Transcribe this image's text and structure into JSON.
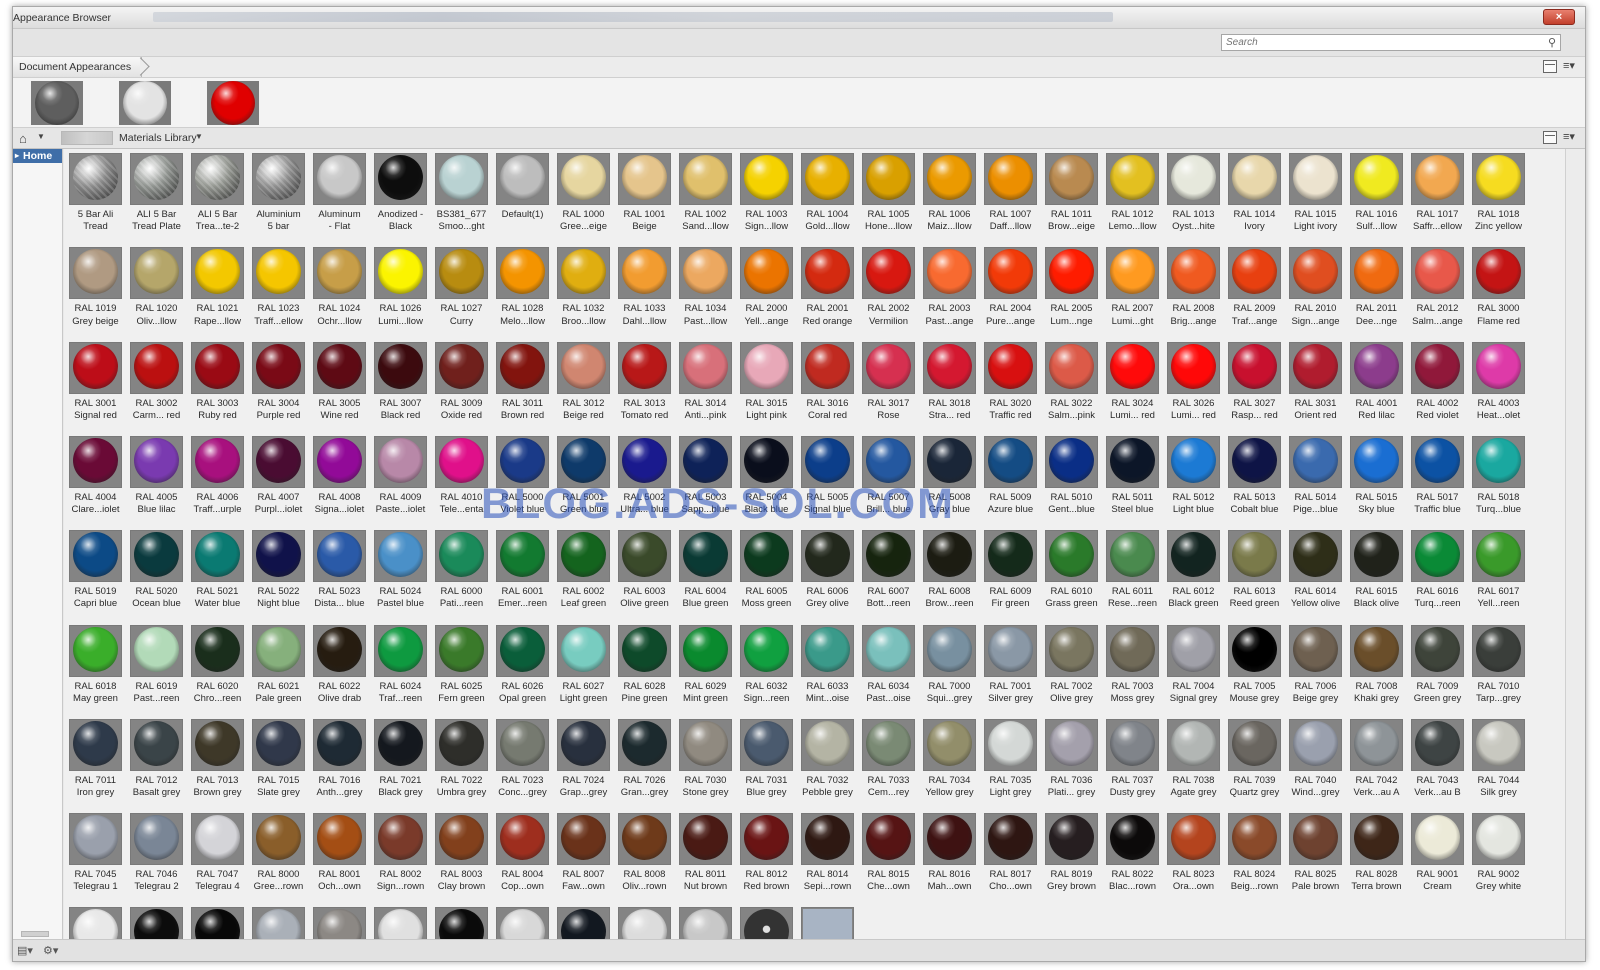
{
  "window": {
    "title": "Appearance Browser",
    "close_label": "×"
  },
  "search": {
    "placeholder": "Search",
    "icon": "search-icon"
  },
  "document": {
    "breadcrumb": "Document Appearances",
    "swatches": [
      {
        "name": "dark-chrome",
        "color": "#5e5e5e"
      },
      {
        "name": "white-matte",
        "color": "#e3e3e3"
      },
      {
        "name": "red-glossy",
        "color": "#e00000"
      }
    ]
  },
  "library": {
    "breadcrumb": "Materials Library",
    "home_icon": "home-icon"
  },
  "sidebar": {
    "items": [
      {
        "label": "Home"
      }
    ]
  },
  "watermark": "BLOG.ADS-SOL.COM",
  "materials": [
    {
      "label": "5 Bar Ali\nTread",
      "color": "#8a8a8a",
      "pattern": "tread"
    },
    {
      "label": "ALI 5 Bar\nTread Plate",
      "color": "#8f938f",
      "pattern": "tread"
    },
    {
      "label": "ALI 5 Bar\nTrea...te-2",
      "color": "#939690",
      "pattern": "tread"
    },
    {
      "label": "Aluminium\n5 bar",
      "color": "#8f8f8f",
      "pattern": "tread"
    },
    {
      "label": "Aluminum\n- Flat",
      "color": "#c8c8c8"
    },
    {
      "label": "Anodized -\nBlack",
      "color": "#0d0d0d"
    },
    {
      "label": "BS381_677\nSmoo...ght",
      "color": "#b9d2d2"
    },
    {
      "label": "Default(1)",
      "color": "#bdbdbd"
    },
    {
      "label": "RAL 1000\nGree...eige",
      "color": "#e6d6a0"
    },
    {
      "label": "RAL 1001\nBeige",
      "color": "#e5c58c"
    },
    {
      "label": "RAL 1002\nSand...llow",
      "color": "#e0c06c"
    },
    {
      "label": "RAL 1003\nSign...llow",
      "color": "#f5d200"
    },
    {
      "label": "RAL 1004\nGold...llow",
      "color": "#e8b000"
    },
    {
      "label": "RAL 1005\nHone...llow",
      "color": "#d9a000"
    },
    {
      "label": "RAL 1006\nMaiz...llow",
      "color": "#eb9a00"
    },
    {
      "label": "RAL 1007\nDaff...llow",
      "color": "#ec8f00"
    },
    {
      "label": "RAL 1011\nBrow...eige",
      "color": "#b98a50"
    },
    {
      "label": "RAL 1012\nLemo...llow",
      "color": "#e3c020"
    },
    {
      "label": "RAL 1013\nOyst...hite",
      "color": "#e6e8dc"
    },
    {
      "label": "RAL 1014\nIvory",
      "color": "#e8d7ab"
    },
    {
      "label": "RAL 1015\nLight ivory",
      "color": "#ece3cf"
    },
    {
      "label": "RAL 1016\nSulf...llow",
      "color": "#f0ea20"
    },
    {
      "label": "RAL 1017\nSaffr...ellow",
      "color": "#f2a850"
    },
    {
      "label": "RAL 1018\nZinc yellow",
      "color": "#f6dc20"
    },
    {
      "label": "RAL 1019\nGrey beige",
      "color": "#b09a82"
    },
    {
      "label": "RAL 1020\nOliv...llow",
      "color": "#b5a66a"
    },
    {
      "label": "RAL 1021\nRape...llow",
      "color": "#f3c800"
    },
    {
      "label": "RAL 1023\nTraff...ellow",
      "color": "#f5c600"
    },
    {
      "label": "RAL 1024\nOchr...llow",
      "color": "#c79e48"
    },
    {
      "label": "RAL 1026\nLumi...llow",
      "color": "#fbf400"
    },
    {
      "label": "RAL 1027\nCurry",
      "color": "#b88c10"
    },
    {
      "label": "RAL 1028\nMelo...llow",
      "color": "#f49400"
    },
    {
      "label": "RAL 1032\nBroo...llow",
      "color": "#e0ae10"
    },
    {
      "label": "RAL 1033\nDahl...llow",
      "color": "#f29c30"
    },
    {
      "label": "RAL 1034\nPast...llow",
      "color": "#eca860"
    },
    {
      "label": "RAL 2000\nYell...ange",
      "color": "#eb7400"
    },
    {
      "label": "RAL 2001\nRed orange",
      "color": "#d42a10"
    },
    {
      "label": "RAL 2002\nVermilion",
      "color": "#d81810"
    },
    {
      "label": "RAL 2003\nPast...ange",
      "color": "#f86a30"
    },
    {
      "label": "RAL 2004\nPure...ange",
      "color": "#f23a08"
    },
    {
      "label": "RAL 2005\nLum...nge",
      "color": "#ff1c00"
    },
    {
      "label": "RAL 2007\nLumi...ght",
      "color": "#ff9a20"
    },
    {
      "label": "RAL 2008\nBrig...ange",
      "color": "#f05a20"
    },
    {
      "label": "RAL 2009\nTraf...ange",
      "color": "#e84010"
    },
    {
      "label": "RAL 2010\nSign...ange",
      "color": "#e04e20"
    },
    {
      "label": "RAL 2011\nDee...nge",
      "color": "#f06a10"
    },
    {
      "label": "RAL 2012\nSalm...ange",
      "color": "#e8584a"
    },
    {
      "label": "RAL 3000\nFlame red",
      "color": "#c41414"
    },
    {
      "label": "RAL 3001\nSignal red",
      "color": "#bd0d18"
    },
    {
      "label": "RAL 3002\nCarm... red",
      "color": "#bb1010"
    },
    {
      "label": "RAL 3003\nRuby red",
      "color": "#9a0a14"
    },
    {
      "label": "RAL 3004\nPurple red",
      "color": "#7a0a16"
    },
    {
      "label": "RAL 3005\nWine red",
      "color": "#5e0a14"
    },
    {
      "label": "RAL 3007\nBlack red",
      "color": "#3c0a0e"
    },
    {
      "label": "RAL 3009\nOxide red",
      "color": "#70201c"
    },
    {
      "label": "RAL 3011\nBrown red",
      "color": "#82140e"
    },
    {
      "label": "RAL 3012\nBeige red",
      "color": "#d08670"
    },
    {
      "label": "RAL 3013\nTomato red",
      "color": "#b81818"
    },
    {
      "label": "RAL 3014\nAnti...pink",
      "color": "#d8707a"
    },
    {
      "label": "RAL 3015\nLight pink",
      "color": "#e8a8b8"
    },
    {
      "label": "RAL 3016\nCoral red",
      "color": "#c02a20"
    },
    {
      "label": "RAL 3017\nRose",
      "color": "#d63050"
    },
    {
      "label": "RAL 3018\nStra... red",
      "color": "#d41830"
    },
    {
      "label": "RAL 3020\nTraffic red",
      "color": "#d81010"
    },
    {
      "label": "RAL 3022\nSalm...pink",
      "color": "#dc5a48"
    },
    {
      "label": "RAL 3024\nLumi... red",
      "color": "#ff0a0a"
    },
    {
      "label": "RAL 3026\nLumi... red",
      "color": "#ff0808"
    },
    {
      "label": "RAL 3027\nRasp... red",
      "color": "#c8102e"
    },
    {
      "label": "RAL 3031\nOrient red",
      "color": "#b01c2e"
    },
    {
      "label": "RAL 4001\nRed lilac",
      "color": "#8c3c8c"
    },
    {
      "label": "RAL 4002\nRed violet",
      "color": "#90183a"
    },
    {
      "label": "RAL 4003\nHeat...olet",
      "color": "#de3aa8"
    },
    {
      "label": "RAL 4004\nClare...iolet",
      "color": "#6a0a36"
    },
    {
      "label": "RAL 4005\nBlue lilac",
      "color": "#7a3ab0"
    },
    {
      "label": "RAL 4006\nTraff...urple",
      "color": "#a8107e"
    },
    {
      "label": "RAL 4007\nPurpl...iolet",
      "color": "#4a0c32"
    },
    {
      "label": "RAL 4008\nSigna...iolet",
      "color": "#920a98"
    },
    {
      "label": "RAL 4009\nPaste...iolet",
      "color": "#b888a8"
    },
    {
      "label": "RAL 4010\nTele...enta",
      "color": "#e0108a"
    },
    {
      "label": "RAL 5000\nViolet blue",
      "color": "#1a3a88"
    },
    {
      "label": "RAL 5001\nGreen blue",
      "color": "#0e3a6a"
    },
    {
      "label": "RAL 5002\nUltra... blue",
      "color": "#1a1a8e"
    },
    {
      "label": "RAL 5003\nSapp...blue",
      "color": "#0e2258"
    },
    {
      "label": "RAL 5004\nBlack blue",
      "color": "#0a0e1c"
    },
    {
      "label": "RAL 5005\nSignal blue",
      "color": "#0c3e8a"
    },
    {
      "label": "RAL 5007\nBrill... blue",
      "color": "#2458a0"
    },
    {
      "label": "RAL 5008\nGray blue",
      "color": "#1a2638"
    },
    {
      "label": "RAL 5009\nAzure blue",
      "color": "#144c84"
    },
    {
      "label": "RAL 5010\nGent...blue",
      "color": "#0a2e86"
    },
    {
      "label": "RAL 5011\nSteel blue",
      "color": "#0c1628"
    },
    {
      "label": "RAL 5012\nLight blue",
      "color": "#1c7ad4"
    },
    {
      "label": "RAL 5013\nCobalt blue",
      "color": "#0e1446"
    },
    {
      "label": "RAL 5014\nPige...blue",
      "color": "#3a6aae"
    },
    {
      "label": "RAL 5015\nSky blue",
      "color": "#1a6ed2"
    },
    {
      "label": "RAL 5017\nTraffic blue",
      "color": "#0c52a4"
    },
    {
      "label": "RAL 5018\nTurq...blue",
      "color": "#1aa8a0"
    },
    {
      "label": "RAL 5019\nCapri blue",
      "color": "#0c4a86"
    },
    {
      "label": "RAL 5020\nOcean blue",
      "color": "#0a3a3e"
    },
    {
      "label": "RAL 5021\nWater blue",
      "color": "#0a7a72"
    },
    {
      "label": "RAL 5022\nNight blue",
      "color": "#10124a"
    },
    {
      "label": "RAL 5023\nDista... blue",
      "color": "#2a5aa8"
    },
    {
      "label": "RAL 5024\nPastel blue",
      "color": "#4a90c8"
    },
    {
      "label": "RAL 6000\nPati...reen",
      "color": "#1a8a5a"
    },
    {
      "label": "RAL 6001\nEmer...reen",
      "color": "#127a30"
    },
    {
      "label": "RAL 6002\nLeaf green",
      "color": "#14641e"
    },
    {
      "label": "RAL 6003\nOlive green",
      "color": "#3a4a2a"
    },
    {
      "label": "RAL 6004\nBlue green",
      "color": "#0a3a34"
    },
    {
      "label": "RAL 6005\nMoss green",
      "color": "#0c3a1e"
    },
    {
      "label": "RAL 6006\nGrey olive",
      "color": "#22281c"
    },
    {
      "label": "RAL 6007\nBott...reen",
      "color": "#16240e"
    },
    {
      "label": "RAL 6008\nBrow...reen",
      "color": "#1c1c12"
    },
    {
      "label": "RAL 6009\nFir green",
      "color": "#142a1a"
    },
    {
      "label": "RAL 6010\nGrass green",
      "color": "#2a7a2a"
    },
    {
      "label": "RAL 6011\nRese...reen",
      "color": "#4a8a4e"
    },
    {
      "label": "RAL 6012\nBlack green",
      "color": "#122420"
    },
    {
      "label": "RAL 6013\nReed green",
      "color": "#7a7a4a"
    },
    {
      "label": "RAL 6014\nYellow olive",
      "color": "#2e2e18"
    },
    {
      "label": "RAL 6015\nBlack olive",
      "color": "#20221a"
    },
    {
      "label": "RAL 6016\nTurq...reen",
      "color": "#0a8a36"
    },
    {
      "label": "RAL 6017\nYell...reen",
      "color": "#3a9a2a"
    },
    {
      "label": "RAL 6018\nMay green",
      "color": "#3aae2a"
    },
    {
      "label": "RAL 6019\nPast...reen",
      "color": "#b2dab8"
    },
    {
      "label": "RAL 6020\nChro...reen",
      "color": "#1a2e1c"
    },
    {
      "label": "RAL 6021\nPale green",
      "color": "#86b07c"
    },
    {
      "label": "RAL 6022\nOlive drab",
      "color": "#261c10"
    },
    {
      "label": "RAL 6024\nTraf...reen",
      "color": "#0e9a40"
    },
    {
      "label": "RAL 6025\nFern green",
      "color": "#3a7a2a"
    },
    {
      "label": "RAL 6026\nOpal green",
      "color": "#0a5e3a"
    },
    {
      "label": "RAL 6027\nLight green",
      "color": "#78ccc0"
    },
    {
      "label": "RAL 6028\nPine green",
      "color": "#0e4a2a"
    },
    {
      "label": "RAL 6029\nMint green",
      "color": "#0a8a2e"
    },
    {
      "label": "RAL 6032\nSign...reen",
      "color": "#10a040"
    },
    {
      "label": "RAL 6033\nMint...oise",
      "color": "#3a9a8a"
    },
    {
      "label": "RAL 6034\nPast...oise",
      "color": "#7ac0bc"
    },
    {
      "label": "RAL 7000\nSqui...grey",
      "color": "#7890a0"
    },
    {
      "label": "RAL 7001\nSilver grey",
      "color": "#8a98a6"
    },
    {
      "label": "RAL 7002\nOlive grey",
      "color": "#7a7660"
    },
    {
      "label": "RAL 7003\nMoss grey",
      "color": "#706a58"
    },
    {
      "label": "RAL 7004\nSignal grey",
      "color": "#a0a0a8"
    },
    {
      "label": "RAL 7005\nMouse grey",
      "color": "#000000"
    },
    {
      "label": "RAL 7006\nBeige grey",
      "color": "#6e6050"
    },
    {
      "label": "RAL 7008\nKhaki grey",
      "color": "#6a4e2a"
    },
    {
      "label": "RAL 7009\nGreen grey",
      "color": "#3e443a"
    },
    {
      "label": "RAL 7010\nTarp...grey",
      "color": "#3a3e3a"
    },
    {
      "label": "RAL 7011\nIron grey",
      "color": "#2e3a4a"
    },
    {
      "label": "RAL 7012\nBasalt grey",
      "color": "#3a4448"
    },
    {
      "label": "RAL 7013\nBrown grey",
      "color": "#3e3828"
    },
    {
      "label": "RAL 7015\nSlate grey",
      "color": "#30384a"
    },
    {
      "label": "RAL 7016\nAnth...grey",
      "color": "#1e2a34"
    },
    {
      "label": "RAL 7021\nBlack grey",
      "color": "#14181e"
    },
    {
      "label": "RAL 7022\nUmbra grey",
      "color": "#2e2e2a"
    },
    {
      "label": "RAL 7023\nConc...grey",
      "color": "#767a70"
    },
    {
      "label": "RAL 7024\nGrap...grey",
      "color": "#28303e"
    },
    {
      "label": "RAL 7026\nGran...grey",
      "color": "#1c2a2e"
    },
    {
      "label": "RAL 7030\nStone grey",
      "color": "#908a80"
    },
    {
      "label": "RAL 7031\nBlue grey",
      "color": "#4a5a6e"
    },
    {
      "label": "RAL 7032\nPebble grey",
      "color": "#b4b4a4"
    },
    {
      "label": "RAL 7033\nCem...rey",
      "color": "#7a8a74"
    },
    {
      "label": "RAL 7034\nYellow grey",
      "color": "#928e6a"
    },
    {
      "label": "RAL 7035\nLight grey",
      "color": "#d4d8d6"
    },
    {
      "label": "RAL 7036\nPlati... grey",
      "color": "#a4a0ac"
    },
    {
      "label": "RAL 7037\nDusty grey",
      "color": "#80848a"
    },
    {
      "label": "RAL 7038\nAgate grey",
      "color": "#b2b6b4"
    },
    {
      "label": "RAL 7039\nQuartz grey",
      "color": "#6a6660"
    },
    {
      "label": "RAL 7040\nWind...grey",
      "color": "#9aa0ae"
    },
    {
      "label": "RAL 7042\nVerk...au A",
      "color": "#8e9498"
    },
    {
      "label": "RAL 7043\nVerk...au B",
      "color": "#3e4444"
    },
    {
      "label": "RAL 7044\nSilk grey",
      "color": "#c8c8c0"
    },
    {
      "label": "RAL 7045\nTelegrau 1",
      "color": "#9aa0ac"
    },
    {
      "label": "RAL 7046\nTelegrau 2",
      "color": "#7a8696"
    },
    {
      "label": "RAL 7047\nTelegrau 4",
      "color": "#d4d4d8"
    },
    {
      "label": "RAL 8000\nGree...rown",
      "color": "#8a5e2a"
    },
    {
      "label": "RAL 8001\nOch...own",
      "color": "#a44e14"
    },
    {
      "label": "RAL 8002\nSign...rown",
      "color": "#7a3a2a"
    },
    {
      "label": "RAL 8003\nClay brown",
      "color": "#82401c"
    },
    {
      "label": "RAL 8004\nCop...own",
      "color": "#9e2e1e"
    },
    {
      "label": "RAL 8007\nFaw...own",
      "color": "#6a321a"
    },
    {
      "label": "RAL 8008\nOliv...rown",
      "color": "#6e3a1a"
    },
    {
      "label": "RAL 8011\nNut brown",
      "color": "#4a1a14"
    },
    {
      "label": "RAL 8012\nRed brown",
      "color": "#6a1414"
    },
    {
      "label": "RAL 8014\nSepi...rown",
      "color": "#2e1812"
    },
    {
      "label": "RAL 8015\nChe...own",
      "color": "#561414"
    },
    {
      "label": "RAL 8016\nMah...own",
      "color": "#3e1212"
    },
    {
      "label": "RAL 8017\nCho...own",
      "color": "#2e1612"
    },
    {
      "label": "RAL 8019\nGrey brown",
      "color": "#261e20"
    },
    {
      "label": "RAL 8022\nBlac...rown",
      "color": "#0c0a0a"
    },
    {
      "label": "RAL 8023\nOra...own",
      "color": "#b4441e"
    },
    {
      "label": "RAL 8024\nBeig...rown",
      "color": "#8a4a2a"
    },
    {
      "label": "RAL 8025\nPale brown",
      "color": "#6e4230"
    },
    {
      "label": "RAL 8028\nTerra brown",
      "color": "#3e2618"
    },
    {
      "label": "RAL 9001\nCream",
      "color": "#ecead8"
    },
    {
      "label": "RAL 9002\nGrey white",
      "color": "#e4e6e0"
    },
    {
      "label": "",
      "color": "#e8e8e8"
    },
    {
      "label": "",
      "color": "#0c0c0c"
    },
    {
      "label": "",
      "color": "#080808"
    },
    {
      "label": "",
      "color": "#aab0b8"
    },
    {
      "label": "",
      "color": "#8c8884"
    },
    {
      "label": "",
      "color": "#e0e0e0"
    },
    {
      "label": "",
      "color": "#0a0a0a"
    },
    {
      "label": "",
      "color": "#d8d8d8"
    },
    {
      "label": "",
      "color": "#121820"
    },
    {
      "label": "",
      "color": "#dcdcdc"
    },
    {
      "label": "",
      "color": "#c8c8c8"
    },
    {
      "label": "",
      "color": "#5a5a5a",
      "pattern": "dark"
    },
    {
      "label": "",
      "color": "#a8b4c4",
      "pattern": "flat"
    }
  ]
}
